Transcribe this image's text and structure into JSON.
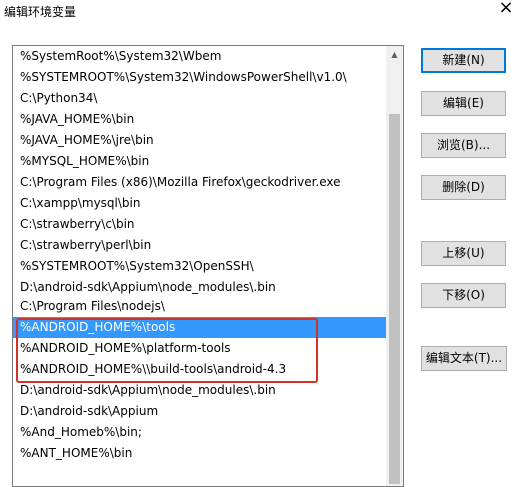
{
  "window": {
    "title": "编辑环境变量",
    "close_glyph": "×"
  },
  "list": {
    "items": [
      "%SystemRoot%\\System32\\Wbem",
      "%SYSTEMROOT%\\System32\\WindowsPowerShell\\v1.0\\",
      "C:\\Python34\\",
      "%JAVA_HOME%\\bin",
      "%JAVA_HOME%\\jre\\bin",
      "%MYSQL_HOME%\\bin",
      "C:\\Program Files (x86)\\Mozilla Firefox\\geckodriver.exe",
      "C:\\xampp\\mysql\\bin",
      "C:\\strawberry\\c\\bin",
      "C:\\strawberry\\perl\\bin",
      "%SYSTEMROOT%\\System32\\OpenSSH\\",
      "D:\\android-sdk\\Appium\\node_modules\\.bin",
      "C:\\Program Files\\nodejs\\",
      "%ANDROID_HOME%\\tools",
      "%ANDROID_HOME%\\platform-tools",
      "%ANDROID_HOME%\\\\build-tools\\android-4.3",
      "D:\\android-sdk\\Appium\\node_modules\\.bin",
      "D:\\android-sdk\\Appium",
      "%And_Homeb%\\bin;",
      "%ANT_HOME%\\bin"
    ],
    "selected_index": 13
  },
  "buttons": {
    "new": "新建(N)",
    "edit": "编辑(E)",
    "browse": "浏览(B)...",
    "delete": "删除(D)",
    "move_up": "上移(U)",
    "move_down": "下移(O)",
    "edit_text": "编辑文本(T)..."
  },
  "colors": {
    "selection": "#3399ff",
    "highlight_box": "#d3302a"
  }
}
